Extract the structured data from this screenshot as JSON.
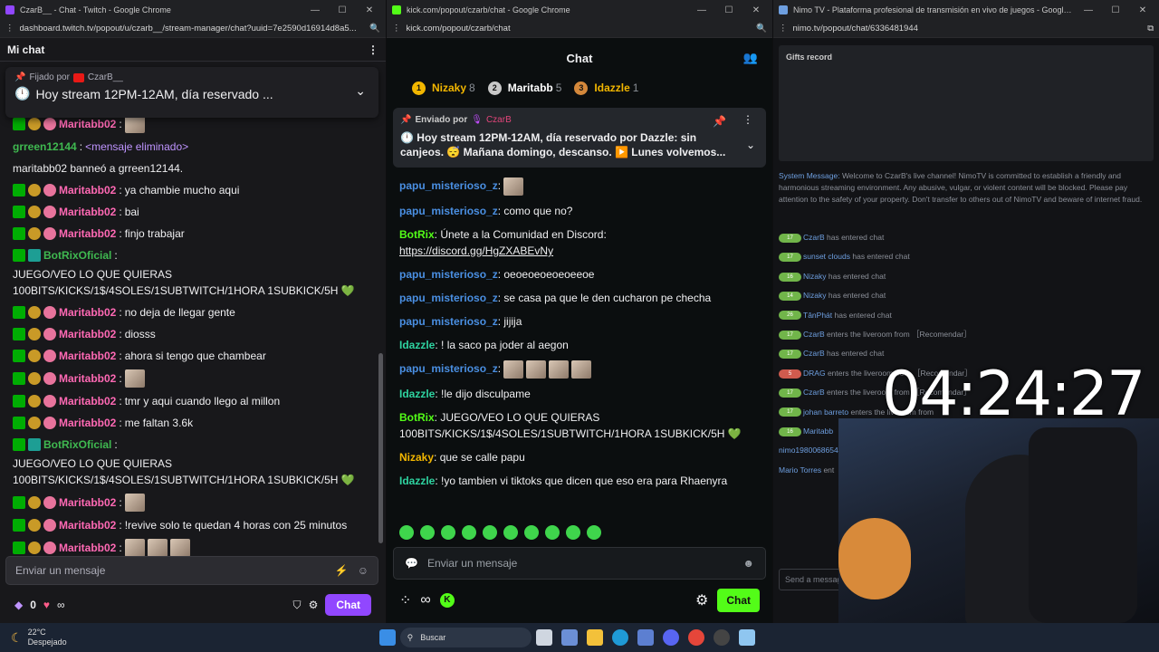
{
  "twitch": {
    "window_title": "CzarB__ - Chat - Twitch - Google Chrome",
    "url": "dashboard.twitch.tv/popout/u/czarb__/stream-manager/chat?uuid=7e2590d16914d8a5...",
    "header": "Mi chat",
    "pinned_by": "Fijado por",
    "pinned_user": "CzarB__",
    "pinned_text": "Hoy stream 12PM-12AM, día reservado ...",
    "messages": [
      {
        "user": "Maritabb02",
        "sep": ":",
        "text": "",
        "emote": true,
        "color": "#ff69b4",
        "badges": [
          "mod",
          "sub",
          "flw"
        ]
      },
      {
        "user": "grreen12144",
        "sep": ":",
        "text": "<mensaje eliminado>",
        "color": "#3fb950",
        "badges": [],
        "deleted": true
      },
      {
        "user": "",
        "sep": "",
        "text": "maritabb02 banneó a grreen12144.",
        "color": "#efeff1",
        "badges": []
      },
      {
        "user": "Maritabb02",
        "sep": ":",
        "text": "ya chambie mucho aqui",
        "color": "#ff69b4",
        "badges": [
          "mod",
          "sub",
          "flw"
        ]
      },
      {
        "user": "Maritabb02",
        "sep": ":",
        "text": "bai",
        "color": "#ff69b4",
        "badges": [
          "mod",
          "sub",
          "flw"
        ]
      },
      {
        "user": "Maritabb02",
        "sep": ":",
        "text": "finjo trabajar",
        "color": "#ff69b4",
        "badges": [
          "mod",
          "sub",
          "flw"
        ]
      },
      {
        "user": "BotRixOficial",
        "sep": ":",
        "text": "JUEGO/VEO LO QUE QUIERAS 100BITS/KICKS/1$/4SOLES/1SUBTWITCH/1HORA 1SUBKICK/5H 💚",
        "color": "#3fb950",
        "badges": [
          "mod",
          "bot"
        ]
      },
      {
        "user": "Maritabb02",
        "sep": ":",
        "text": "no deja de llegar gente",
        "color": "#ff69b4",
        "badges": [
          "mod",
          "sub",
          "flw"
        ]
      },
      {
        "user": "Maritabb02",
        "sep": ":",
        "text": "diosss",
        "color": "#ff69b4",
        "badges": [
          "mod",
          "sub",
          "flw"
        ]
      },
      {
        "user": "Maritabb02",
        "sep": ":",
        "text": "ahora si tengo que chambear",
        "color": "#ff69b4",
        "badges": [
          "mod",
          "sub",
          "flw"
        ]
      },
      {
        "user": "Maritabb02",
        "sep": ":",
        "text": "",
        "emote": true,
        "color": "#ff69b4",
        "badges": [
          "mod",
          "sub",
          "flw"
        ]
      },
      {
        "user": "Maritabb02",
        "sep": ":",
        "text": "tmr y aqui cuando llego al millon",
        "color": "#ff69b4",
        "badges": [
          "mod",
          "sub",
          "flw"
        ]
      },
      {
        "user": "Maritabb02",
        "sep": ":",
        "text": "me faltan 3.6k",
        "color": "#ff69b4",
        "badges": [
          "mod",
          "sub",
          "flw"
        ]
      },
      {
        "user": "BotRixOficial",
        "sep": ":",
        "text": "JUEGO/VEO LO QUE QUIERAS 100BITS/KICKS/1$/4SOLES/1SUBTWITCH/1HORA 1SUBKICK/5H 💚",
        "color": "#3fb950",
        "badges": [
          "mod",
          "bot"
        ]
      },
      {
        "user": "Maritabb02",
        "sep": ":",
        "text": "",
        "emote": true,
        "color": "#ff69b4",
        "badges": [
          "mod",
          "sub",
          "flw"
        ]
      },
      {
        "user": "Maritabb02",
        "sep": ":",
        "text": "!revive solo te quedan 4 horas con 25 minutos",
        "color": "#ff69b4",
        "badges": [
          "mod",
          "sub",
          "flw"
        ]
      },
      {
        "user": "Maritabb02",
        "sep": ":",
        "text": "",
        "emote": true,
        "emotes": 3,
        "color": "#ff69b4",
        "badges": [
          "mod",
          "sub",
          "flw"
        ]
      }
    ],
    "input_placeholder": "Enviar un mensaje",
    "points": "0",
    "infinity": "∞",
    "chat_button": "Chat"
  },
  "kick": {
    "window_title": "kick.com/popout/czarb/chat - Google Chrome",
    "url": "kick.com/popout/czarb/chat",
    "header": "Chat",
    "top_gifters": [
      {
        "rank": "1",
        "name": "Nizaky",
        "count": "8",
        "color": "#f2b600"
      },
      {
        "rank": "2",
        "name": "Maritabb",
        "count": "5",
        "color": "#c8c8c8"
      },
      {
        "rank": "3",
        "name": "Idazzle",
        "count": "1",
        "color": "#d4883b"
      }
    ],
    "pinned_by": "Enviado por",
    "pinned_user": "CzarB",
    "pinned_text": "🕛 Hoy stream 12PM-12AM, día reservado por Dazzle: sin canjeos. 😴 Mañana domingo, descanso. ▶️ Lunes volvemos...",
    "messages": [
      {
        "user": "papu_misterioso_z",
        "text": "",
        "emote": true,
        "color": "#4a8fe2"
      },
      {
        "user": "papu_misterioso_z",
        "text": "como que no?",
        "color": "#4a8fe2"
      },
      {
        "user": "BotRix",
        "text": "Únete a la Comunidad en Discord:",
        "link": "https://discord.gg/HgZXABEvNy",
        "color": "#53fc18"
      },
      {
        "user": "papu_misterioso_z",
        "text": "oeoeoeoeoeoeeoe",
        "color": "#4a8fe2"
      },
      {
        "user": "papu_misterioso_z",
        "text": "se casa pa que le den cucharon pe checha",
        "color": "#4a8fe2"
      },
      {
        "user": "papu_misterioso_z",
        "text": "jijija",
        "color": "#4a8fe2"
      },
      {
        "user": "Idazzle",
        "text": "! la saco pa joder al aegon",
        "color": "#2ed3a0"
      },
      {
        "user": "papu_misterioso_z",
        "text": "",
        "emote": true,
        "emotes": 4,
        "color": "#4a8fe2"
      },
      {
        "user": "Idazzle",
        "text": "!le dijo disculpame",
        "color": "#2ed3a0"
      },
      {
        "user": "BotRix",
        "text": "JUEGO/VEO LO QUE QUIERAS 100BITS/KICKS/1$/4SOLES/1SUBTWITCH/1HORA 1SUBKICK/5H 💚",
        "color": "#53fc18"
      },
      {
        "user": "Nizaky",
        "text": "que se calle papu",
        "color": "#f2b600"
      },
      {
        "user": "Idazzle",
        "text": "!yo tambien vi tiktoks que dicen que eso era para Rhaenyra",
        "color": "#2ed3a0"
      }
    ],
    "input_placeholder": "Enviar un mensaje",
    "chat_button": "Chat"
  },
  "nimo": {
    "window_title": "Nimo TV - Plataforma profesional de transmisión en vivo de juegos - Google Chrome",
    "url": "nimo.tv/popout/chat/6336481944",
    "gifts_title": "Gifts record",
    "system_label": "System Message:",
    "system_text": "Welcome to CzarB's live channel! NimoTV is committed to establish a friendly and harmonious streaming environment. Any abusive, vulgar, or violent content will be blocked. Please pay attention to the safety of your property. Don't transfer to others out of NimoTV and beware of internet fraud.",
    "entries": [
      {
        "level": "17",
        "name": "CzarB",
        "text": "has entered chat"
      },
      {
        "level": "17",
        "name": "sunset clouds",
        "text": "has entered chat"
      },
      {
        "level": "16",
        "name": "Nizaky",
        "text": "has entered chat"
      },
      {
        "level": "14",
        "name": "Nizaky",
        "text": "has entered chat"
      },
      {
        "level": "26",
        "name": "TânPhát",
        "text": "has entered chat"
      },
      {
        "level": "17",
        "name": "CzarB",
        "text": "enters the liveroom from ［Recomendar］"
      },
      {
        "level": "17",
        "name": "CzarB",
        "text": "has entered chat"
      },
      {
        "level": "5",
        "name": "DRAG",
        "text": "enters the liveroom from ［Recomendar］",
        "red": true
      },
      {
        "level": "17",
        "name": "CzarB",
        "text": "enters the liveroom from ［Recomendar］"
      },
      {
        "level": "17",
        "name": "johan barreto",
        "text": "enters the liveroom from"
      },
      {
        "level": "16",
        "name": "Maritabb",
        "text": ""
      },
      {
        "level": "",
        "name": "nimo1980068654",
        "text": ""
      },
      {
        "level": "",
        "name": "Mario Torres",
        "text": "ent"
      }
    ],
    "input_placeholder": "Send a message"
  },
  "overlay_clock": "04:24:27",
  "taskbar": {
    "temperature": "22°C",
    "weather": "Despejado",
    "search": "Buscar"
  }
}
